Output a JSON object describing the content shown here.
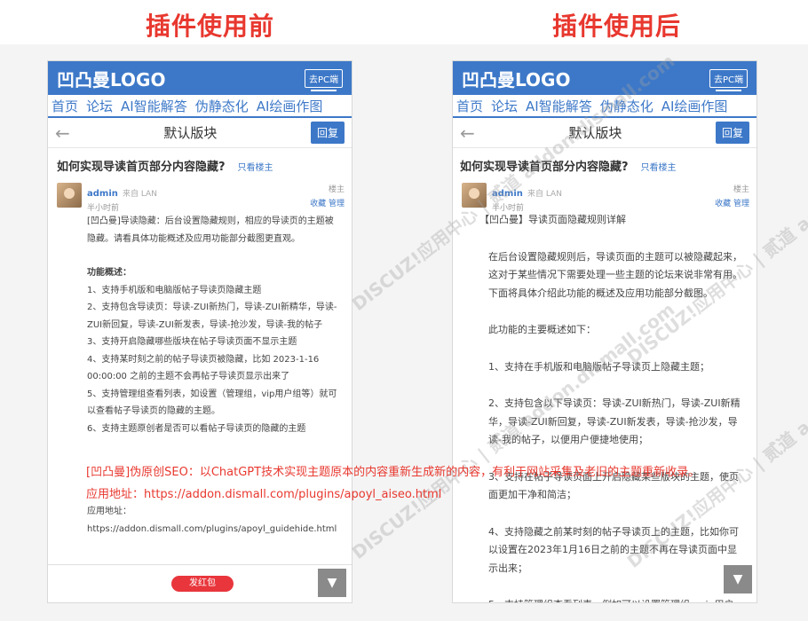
{
  "titles": {
    "before": "插件使用前",
    "after": "插件使用后"
  },
  "phone": {
    "logo": "凹凸曼LOGO",
    "pc_button": "去PC端",
    "nav": [
      "首页",
      "论坛",
      "AI智能解答",
      "伪静态化",
      "AI绘画作图"
    ],
    "back": "←",
    "board": "默认版块",
    "reply": "回复",
    "post_title": "如何实现导读首页部分内容隐藏?",
    "only_author": "只看楼主",
    "author": "admin",
    "from": "来自 LAN",
    "time": "半小时前",
    "floor": "楼主",
    "collect": "收藏",
    "manage": "管理"
  },
  "left": {
    "content": [
      "[凹凸曼]导读隐藏：后台设置隐藏规则，相应的导读页的主题被隐藏。请看具体功能概述及应用功能部分截图更直观。",
      "",
      "功能概述：",
      "1、支持手机版和电脑版帖子导读页隐藏主题",
      "2、支持包含导读页：导读-ZUI新热门，导读-ZUI新精华，导读-ZUI新回复，导读-ZUI新发表，导读-抢沙发，导读-我的帖子",
      "3、支持开启隐藏哪些版块在帖子导读页面不显示主题",
      "4、支持某时刻之前的帖子导读页被隐藏，比如 2023-1-16 00:00:00 之前的主题不会再帖子导读页显示出来了",
      "5、支持管理组查看列表，如设置（管理组，vip用户组等）就可以查看帖子导读页的隐藏的主题。",
      "6、支持主题原创者是否可以看帖子导读页的隐藏的主题"
    ],
    "app_label": "应用地址：",
    "app_url": "https://addon.dismall.com/plugins/apoyl_guidehide.html",
    "red_packet": "发红包"
  },
  "right": {
    "content": [
      "【凹凸曼】导读页面隐藏规则详解",
      "",
      "在后台设置隐藏规则后，导读页面的主题可以被隐藏起来，这对于某些情况下需要处理一些主题的论坛来说非常有用。下面将具体介绍此功能的概述及应用功能部分截图。",
      "",
      "此功能的主要概述如下：",
      "",
      "1、支持在手机版和电脑版帖子导读页上隐藏主题；",
      "",
      "2、支持包含以下导读页：导读-ZUI新热门，导读-ZUI新精华，导读-ZUI新回复，导读-ZUI新发表，导读-抢沙发，导读-我的帖子，以便用户便捷地使用；",
      "",
      "3、支持在帖子导读页面上开启隐藏某些版块的主题，使页面更加干净和简洁；",
      "",
      "4、支持隐藏之前某时刻的帖子导读页上的主题，比如你可以设置在2023年1月16日之前的主题不再在导读页面中显示出来；",
      "",
      "5、支持管理组查看列表，例如可以设置管理组，vip用户"
    ]
  },
  "overlay": {
    "line1": "[凹凸曼]伪原创SEO：以ChatGPT技术实现主题原本的内容重新生成新的内容，有利于网站采集及老旧的主题重新收录。",
    "line2": "应用地址：https://addon.dismall.com/plugins/apoyl_aiseo.html"
  },
  "watermark": "DISCUZ!应用中心 | 贰道 addon.dismall.com",
  "icons": {
    "scroll_down": "chevron-down-icon",
    "back": "arrow-left-icon"
  },
  "colors": {
    "brand": "#3d78c8",
    "accent_red": "#e8382f"
  }
}
